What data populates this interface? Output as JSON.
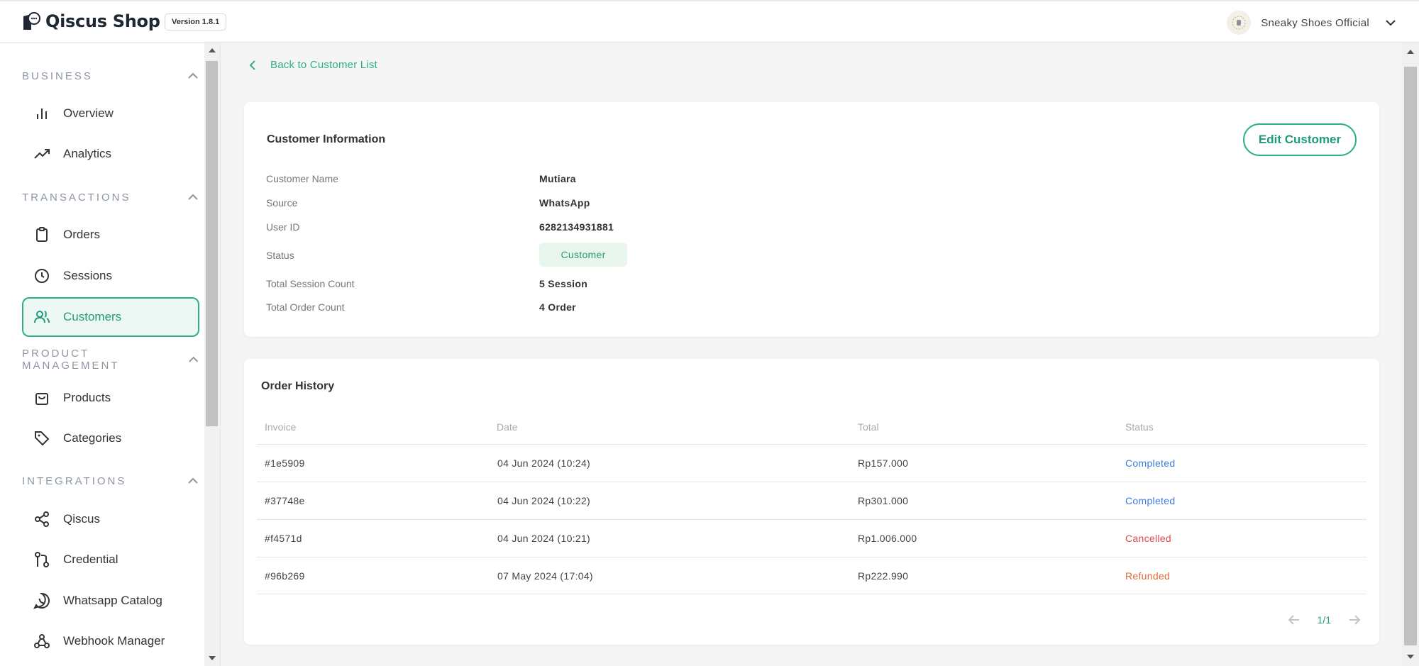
{
  "header": {
    "app_title": "Qiscus Shop",
    "version": "Version 1.8.1",
    "user_name": "Sneaky Shoes Official"
  },
  "sidebar": {
    "sections": [
      {
        "title": "BUSINESS",
        "items": [
          {
            "label": "Overview",
            "icon": "bar-chart-icon"
          },
          {
            "label": "Analytics",
            "icon": "trending-up-icon"
          }
        ]
      },
      {
        "title": "TRANSACTIONS",
        "items": [
          {
            "label": "Orders",
            "icon": "clipboard-icon"
          },
          {
            "label": "Sessions",
            "icon": "clock-icon"
          },
          {
            "label": "Customers",
            "icon": "users-icon",
            "active": true
          }
        ]
      },
      {
        "title": "PRODUCT MANAGEMENT",
        "items": [
          {
            "label": "Products",
            "icon": "shopping-bag-icon"
          },
          {
            "label": "Categories",
            "icon": "tag-icon"
          }
        ]
      },
      {
        "title": "INTEGRATIONS",
        "items": [
          {
            "label": "Qiscus",
            "icon": "share-icon"
          },
          {
            "label": "Credential",
            "icon": "git-pull-request-icon"
          },
          {
            "label": "Whatsapp Catalog",
            "icon": "whatsapp-icon"
          },
          {
            "label": "Webhook Manager",
            "icon": "webhook-icon"
          }
        ]
      }
    ]
  },
  "back_link": "Back to Customer List",
  "customer_info": {
    "title": "Customer Information",
    "edit_button": "Edit Customer",
    "fields": [
      {
        "label": "Customer Name",
        "value": "Mutiara"
      },
      {
        "label": "Source",
        "value": "WhatsApp"
      },
      {
        "label": "User ID",
        "value": "6282134931881"
      },
      {
        "label": "Status",
        "value": "Customer"
      },
      {
        "label": "Total Session Count",
        "value": "5 Session"
      },
      {
        "label": "Total Order Count",
        "value": "4 Order"
      }
    ]
  },
  "order_history": {
    "title": "Order History",
    "columns": [
      "Invoice",
      "Date",
      "Total",
      "Status"
    ],
    "rows": [
      {
        "invoice": "#1e5909",
        "date": "04 Jun 2024 (10:24)",
        "total": "Rp157.000",
        "status": "Completed"
      },
      {
        "invoice": "#37748e",
        "date": "04 Jun 2024 (10:22)",
        "total": "Rp301.000",
        "status": "Completed"
      },
      {
        "invoice": "#f4571d",
        "date": "04 Jun 2024 (10:21)",
        "total": "Rp1.006.000",
        "status": "Cancelled"
      },
      {
        "invoice": "#96b269",
        "date": "07 May 2024 (17:04)",
        "total": "Rp222.990",
        "status": "Refunded"
      }
    ],
    "status_colors": {
      "Completed": "#3b7de0",
      "Cancelled": "#e04a4a",
      "Refunded": "#e2683a"
    },
    "pagination": "1/1"
  },
  "colors": {
    "accent": "#2fae8c",
    "accent_bg": "#edf8f4"
  }
}
